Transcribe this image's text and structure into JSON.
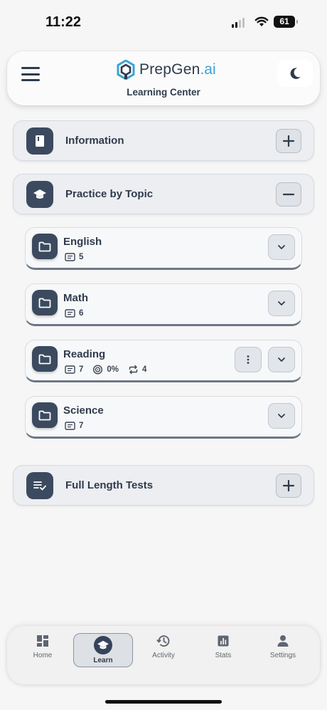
{
  "status": {
    "time": "11:22",
    "battery": "61"
  },
  "header": {
    "brand_main": "PrepGen",
    "brand_accent": ".ai",
    "subtitle": "Learning Center"
  },
  "sections": [
    {
      "title": "Information",
      "toggle": "plus"
    },
    {
      "title": "Practice by Topic",
      "toggle": "minus"
    },
    {
      "title": "Full Length Tests",
      "toggle": "plus"
    }
  ],
  "topics": [
    {
      "title": "English",
      "count": "5"
    },
    {
      "title": "Math",
      "count": "6"
    },
    {
      "title": "Reading",
      "count": "7",
      "progress": "0%",
      "repeats": "4"
    },
    {
      "title": "Science",
      "count": "7"
    }
  ],
  "nav": [
    {
      "label": "Home",
      "icon": "dashboard-icon"
    },
    {
      "label": "Learn",
      "icon": "graduation-cap-icon",
      "active": true
    },
    {
      "label": "Activity",
      "icon": "history-icon"
    },
    {
      "label": "Stats",
      "icon": "bar-chart-icon"
    },
    {
      "label": "Settings",
      "icon": "person-icon"
    }
  ],
  "colors": {
    "accent": "#3aa4d6",
    "dark": "#2f3b4c",
    "icon_bg": "#3b4a5f"
  }
}
